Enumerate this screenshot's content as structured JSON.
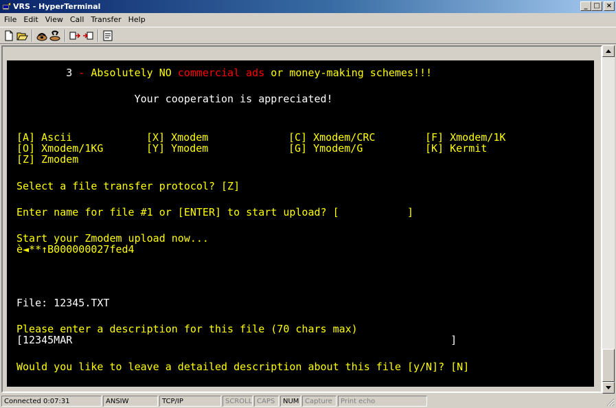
{
  "window": {
    "title": "VRS - HyperTerminal",
    "icon": "hyperterminal-icon",
    "minimize": "_",
    "maximize": "□",
    "close": "×"
  },
  "menu": [
    "File",
    "Edit",
    "View",
    "Call",
    "Transfer",
    "Help"
  ],
  "toolbar": [
    "new-icon",
    "open-icon",
    "connect-icon",
    "disconnect-icon",
    "send-icon",
    "receive-icon",
    "properties-icon"
  ],
  "terminal": {
    "rule_num": "3",
    "rule_dash": "-",
    "rule_a": "Absolutely NO",
    "rule_b": "commercial ads",
    "rule_c": "or money-making schemes!!!",
    "cooperation": "Your cooperation is appreciated!",
    "protocols": [
      [
        "[A] Ascii",
        "[X] Xmodem",
        "[C] Xmodem/CRC",
        "[F] Xmodem/1K"
      ],
      [
        "[O] Xmodem/1KG",
        "[Y] Ymodem",
        "[G] Ymodem/G",
        "[K] Kermit"
      ],
      [
        "[Z] Zmodem"
      ]
    ],
    "select_prompt": "Select a file transfer protocol? [Z]",
    "filename_prompt": "Enter name for file #1 or [ENTER] to start upload? [           ]",
    "upload_now": "Start your Zmodem upload now...",
    "zmodem_garbage": "è◄**↑B000000027fed4",
    "file_line": "File: 12345.TXT",
    "desc_prompt": "Please enter a description for this file (70 chars max)",
    "desc_value": "[12345MAR                                                             ]",
    "detail_prompt": "Would you like to leave a detailed description about this file [y/N]? [N]"
  },
  "status": {
    "connected": "Connected 0:07:31",
    "emulation": "ANSIW",
    "transport": "TCP/IP",
    "scroll": "SCROLL",
    "caps": "CAPS",
    "num": "NUM",
    "capture": "Capture",
    "print_echo": "Print echo"
  },
  "colors": {
    "terminal_bg": "#000000",
    "text_yellow": "#ffff00",
    "text_white": "#ffffff",
    "text_red": "#ff0000"
  }
}
